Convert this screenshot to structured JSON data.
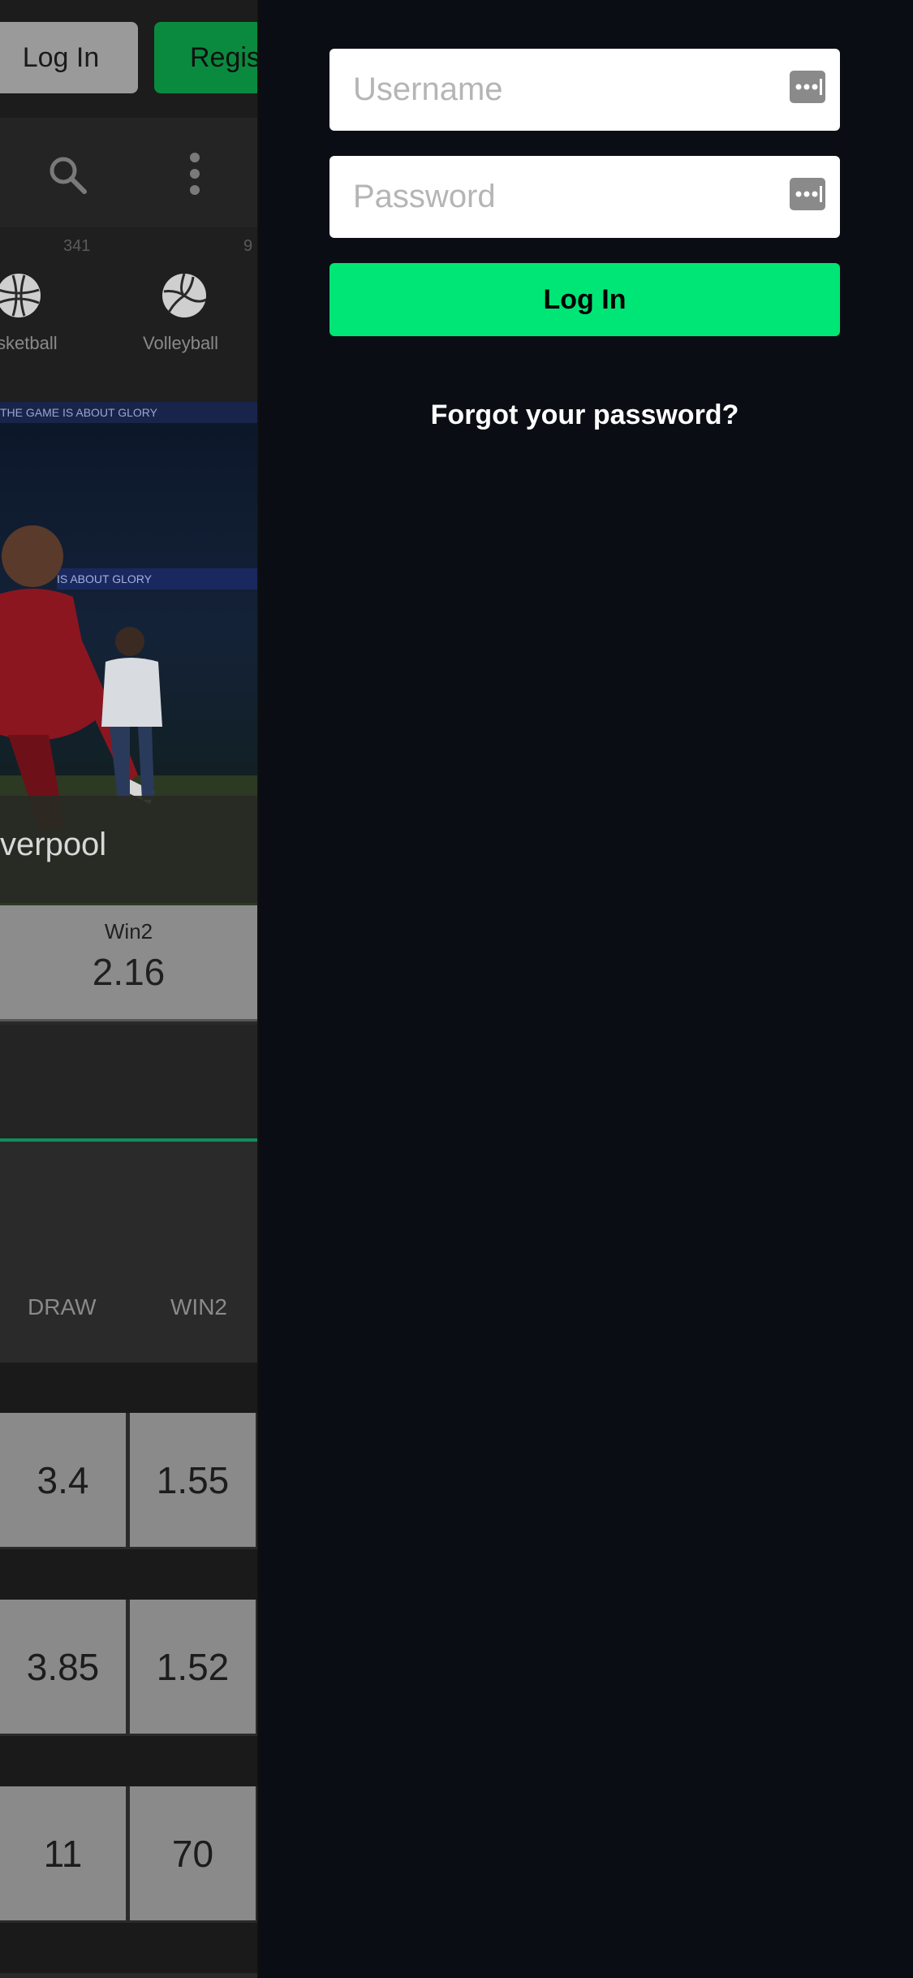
{
  "background_app": {
    "header": {
      "login_label": "Log In",
      "register_label": "Regis"
    },
    "toolbar": {
      "search_icon": "search-icon",
      "menu_icon": "kebab-menu-icon"
    },
    "sports": {
      "counts": [
        "341",
        "9"
      ],
      "items": [
        {
          "label": "sketball",
          "icon": "basketball-icon"
        },
        {
          "label": "Volleyball",
          "icon": "volleyball-icon"
        }
      ]
    },
    "hero": {
      "banner_text": "THE GAME IS ABOUT GLORY",
      "banner_text2": "IS ABOUT GLORY",
      "title": "verpool"
    },
    "featured_odd": {
      "label": "Win2",
      "value": "2.16"
    },
    "table": {
      "headers": [
        "DRAW",
        "WIN2"
      ],
      "rows": [
        {
          "draw": "3.4",
          "win2": "1.55"
        },
        {
          "draw": "3.85",
          "win2": "1.52"
        },
        {
          "draw": "11",
          "win2": "70"
        }
      ]
    }
  },
  "login_panel": {
    "username_placeholder": "Username",
    "password_placeholder": "Password",
    "login_button": "Log In",
    "forgot_password": "Forgot your password?"
  },
  "colors": {
    "accent_green": "#00e676",
    "drawer_bg": "#0a0e14",
    "field_bg": "#ffffff"
  }
}
